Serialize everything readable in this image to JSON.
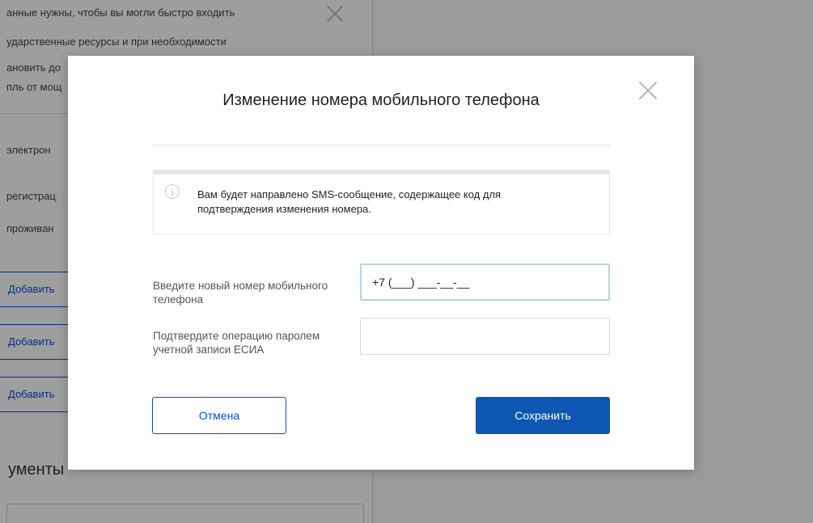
{
  "background": {
    "intro_lines": [
      "анные нужны, чтобы вы могли быстро входить",
      "ударственные ресурсы и при необходимости",
      "ановить до",
      "пль от мощ"
    ],
    "items": [
      "электрон",
      "регистрац",
      "проживан"
    ],
    "add_buttons": [
      "Добавить",
      "Добавить",
      "Добавить"
    ],
    "section_heading": "ументы"
  },
  "modal": {
    "title": "Изменение номера мобильного телефона",
    "info_icon": "i",
    "info_text": "Вам будет направлено SMS-сообщение, содержащее код для подтверждения изменения номера.",
    "phone": {
      "label": "Введите новый номер мобильного телефона",
      "value": "+7 (___) ___-__-__"
    },
    "password": {
      "label": "Подтвердите операцию паролем учетной записи ЕСИА",
      "value": ""
    },
    "cancel_label": "Отмена",
    "save_label": "Сохранить"
  },
  "colors": {
    "primary": "#0d56b4",
    "link": "#0d4cd3",
    "focus_border": "#b7d2ee"
  }
}
